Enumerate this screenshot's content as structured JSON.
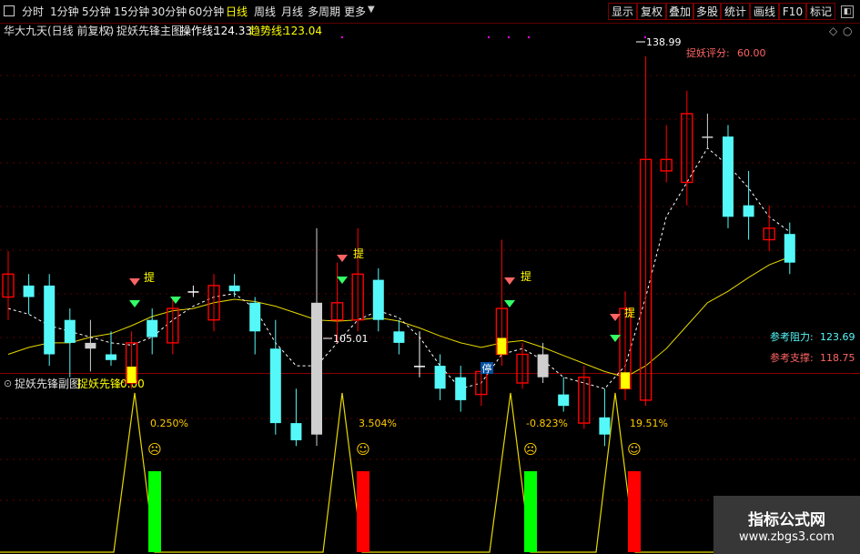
{
  "toolbar": {
    "periods": [
      "分时",
      "1分钟",
      "5分钟",
      "15分钟",
      "30分钟",
      "60分钟",
      "日线",
      "周线",
      "月线",
      "多周期",
      "更多"
    ],
    "active_period": "日线",
    "right_buttons": [
      "显示",
      "复权",
      "叠加",
      "多股",
      "统计",
      "画线",
      "F10",
      "标记"
    ]
  },
  "main_info": {
    "stock": "华大九天(日线 前复权)",
    "indicator": "捉妖先锋主图",
    "op_label": "操作线:",
    "op_value": "124.33",
    "trend_label": "趋势线:",
    "trend_value": "123.04"
  },
  "annotations": {
    "high_price": "138.99",
    "low_price": "105.01",
    "score_label": "捉妖评分:",
    "score_value": "60.00",
    "resist_label": "参考阻力:",
    "resist_value": "123.69",
    "support_label": "参考支撑:",
    "support_value": "118.75",
    "stop_marker": "停",
    "buy_marker": "提"
  },
  "sub_info": {
    "indicator": "捉妖先锋副图",
    "label": "捉妖先锋:",
    "value": "0.00"
  },
  "sub_labels": [
    "0.250%",
    "3.504%",
    "-0.823%",
    "19.51%"
  ],
  "watermark": {
    "title": "指标公式网",
    "url": "www.zbgs3.com"
  },
  "colors": {
    "up": "#ff0000",
    "down": "#54f8f8",
    "flat": "#ffffff",
    "signal": "#ffff00",
    "trend": "#e6d800",
    "green_bar": "#00ff00"
  },
  "chart_data": {
    "type": "candlestick",
    "price_range": [
      103,
      141
    ],
    "candles": [
      {
        "o": 118,
        "c": 120,
        "h": 122,
        "l": 116
      },
      {
        "o": 119,
        "c": 118,
        "h": 120,
        "l": 116.5
      },
      {
        "o": 119,
        "c": 113,
        "h": 120,
        "l": 112
      },
      {
        "o": 116,
        "c": 114,
        "h": 117,
        "l": 111
      },
      {
        "o": 114,
        "c": 113.5,
        "h": 116,
        "l": 111.5
      },
      {
        "o": 113,
        "c": 112.5,
        "h": 115,
        "l": 112
      },
      {
        "o": 110.5,
        "c": 114,
        "h": 115,
        "l": 110
      },
      {
        "o": 116,
        "c": 114.5,
        "h": 117,
        "l": 113
      },
      {
        "o": 114,
        "c": 117,
        "h": 118,
        "l": 113
      },
      {
        "o": 118.5,
        "c": 118.5,
        "h": 119,
        "l": 118
      },
      {
        "o": 116,
        "c": 119,
        "h": 120,
        "l": 115
      },
      {
        "o": 119,
        "c": 118.5,
        "h": 120,
        "l": 118
      },
      {
        "o": 117.5,
        "c": 115,
        "h": 118,
        "l": 113
      },
      {
        "o": 113.5,
        "c": 107,
        "h": 116,
        "l": 106
      },
      {
        "o": 107,
        "c": 105.5,
        "h": 110,
        "l": 105
      },
      {
        "o": 117.5,
        "c": 106,
        "h": 124,
        "l": 105.01
      },
      {
        "o": 116,
        "c": 117.5,
        "h": 121,
        "l": 114
      },
      {
        "o": 116,
        "c": 120,
        "h": 124,
        "l": 115
      },
      {
        "o": 119.5,
        "c": 116,
        "h": 120.5,
        "l": 115
      },
      {
        "o": 115,
        "c": 114,
        "h": 116,
        "l": 113
      },
      {
        "o": 112,
        "c": 112,
        "h": 115,
        "l": 111
      },
      {
        "o": 112,
        "c": 110,
        "h": 113,
        "l": 109
      },
      {
        "o": 111,
        "c": 109,
        "h": 112,
        "l": 108
      },
      {
        "o": 109.5,
        "c": 111.5,
        "h": 112,
        "l": 108.5
      },
      {
        "o": 113,
        "c": 117,
        "h": 123,
        "l": 112
      },
      {
        "o": 110.5,
        "c": 113,
        "h": 114,
        "l": 110
      },
      {
        "o": 113,
        "c": 111,
        "h": 114,
        "l": 110.5
      },
      {
        "o": 109.5,
        "c": 108.5,
        "h": 111,
        "l": 108
      },
      {
        "o": 107,
        "c": 111,
        "h": 112,
        "l": 106.5
      },
      {
        "o": 107.5,
        "c": 106,
        "h": 110,
        "l": 105
      },
      {
        "o": 110,
        "c": 117,
        "h": 118.5,
        "l": 109
      },
      {
        "o": 109,
        "c": 130,
        "h": 138.99,
        "l": 108.5
      },
      {
        "o": 129,
        "c": 130,
        "h": 133,
        "l": 128
      },
      {
        "o": 128,
        "c": 134,
        "h": 136,
        "l": 126
      },
      {
        "o": 132,
        "c": 132,
        "h": 134,
        "l": 131
      },
      {
        "o": 132,
        "c": 125,
        "h": 133,
        "l": 124
      },
      {
        "o": 126,
        "c": 125,
        "h": 129,
        "l": 123
      },
      {
        "o": 123,
        "c": 124,
        "h": 126,
        "l": 122
      },
      {
        "o": 123.5,
        "c": 121,
        "h": 124.5,
        "l": 120
      }
    ],
    "series": [
      {
        "name": "操作线",
        "values": [
          117,
          116.5,
          115.5,
          115,
          114.5,
          114,
          113.8,
          114.5,
          116,
          117.2,
          118,
          118.3,
          117,
          114,
          112,
          112,
          114,
          116,
          116.8,
          116.2,
          114.5,
          112,
          110,
          110.5,
          113,
          113.5,
          112.5,
          111,
          110.5,
          110,
          112,
          118,
          125,
          128,
          131,
          129.5,
          127.5,
          125,
          123.69
        ]
      },
      {
        "name": "趋势线",
        "values": [
          113,
          113.6,
          114,
          114,
          114.5,
          114.8,
          115.5,
          116.3,
          116.8,
          117,
          117.5,
          117.8,
          117.6,
          117.2,
          116.6,
          116,
          115.9,
          116,
          116.2,
          115.9,
          115.3,
          114.6,
          114,
          113.6,
          114,
          114.2,
          113.6,
          112.9,
          112.2,
          111.5,
          111,
          112,
          113.5,
          115.5,
          117.5,
          118.5,
          119.7,
          120.8,
          121.5
        ]
      }
    ],
    "sub_signals": [
      {
        "label": "0.250%",
        "type": "green"
      },
      {
        "label": "3.504%",
        "type": "red"
      },
      {
        "label": "-0.823%",
        "type": "green"
      },
      {
        "label": "19.51%",
        "type": "red"
      }
    ]
  }
}
